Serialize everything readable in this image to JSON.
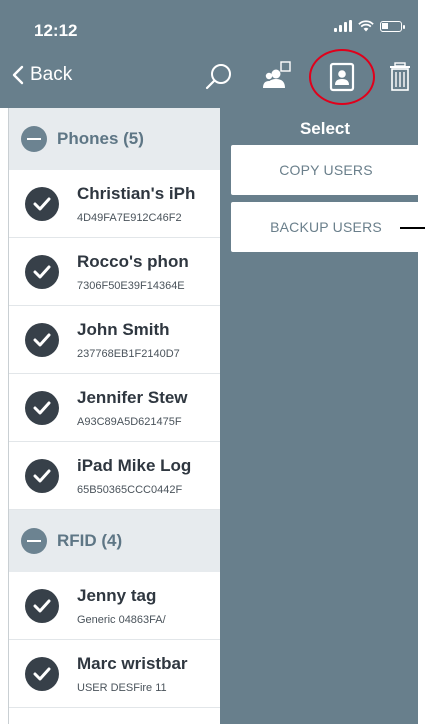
{
  "status_bar": {
    "time": "12:12"
  },
  "nav": {
    "back_label": "Back",
    "icons": [
      "search-icon",
      "users-icon",
      "contact-card-icon",
      "trash-icon"
    ]
  },
  "sections": [
    {
      "title": "Phones (5)",
      "items": [
        {
          "title": "Christian's iPh",
          "subtitle": "4D49FA7E912C46F2"
        },
        {
          "title": "Rocco's phon",
          "subtitle": "7306F50E39F14364E"
        },
        {
          "title": "John Smith",
          "subtitle": "237768EB1F2140D7"
        },
        {
          "title": "Jennifer Stew",
          "subtitle": "A93C89A5D621475F"
        },
        {
          "title": "iPad Mike Log",
          "subtitle": "65B50365CCC0442F"
        }
      ]
    },
    {
      "title": "RFID (4)",
      "items": [
        {
          "title": "Jenny tag",
          "subtitle": "Generic 04863FA/"
        },
        {
          "title": "Marc wristbar",
          "subtitle": "USER DESFire 11"
        }
      ]
    }
  ],
  "panel": {
    "title": "Select",
    "copy_label": "COPY USERS",
    "backup_label": "BACKUP USERS"
  },
  "colors": {
    "header_bg": "#687f8c",
    "highlight_ring": "#e0001b",
    "check_bg": "#374049"
  }
}
